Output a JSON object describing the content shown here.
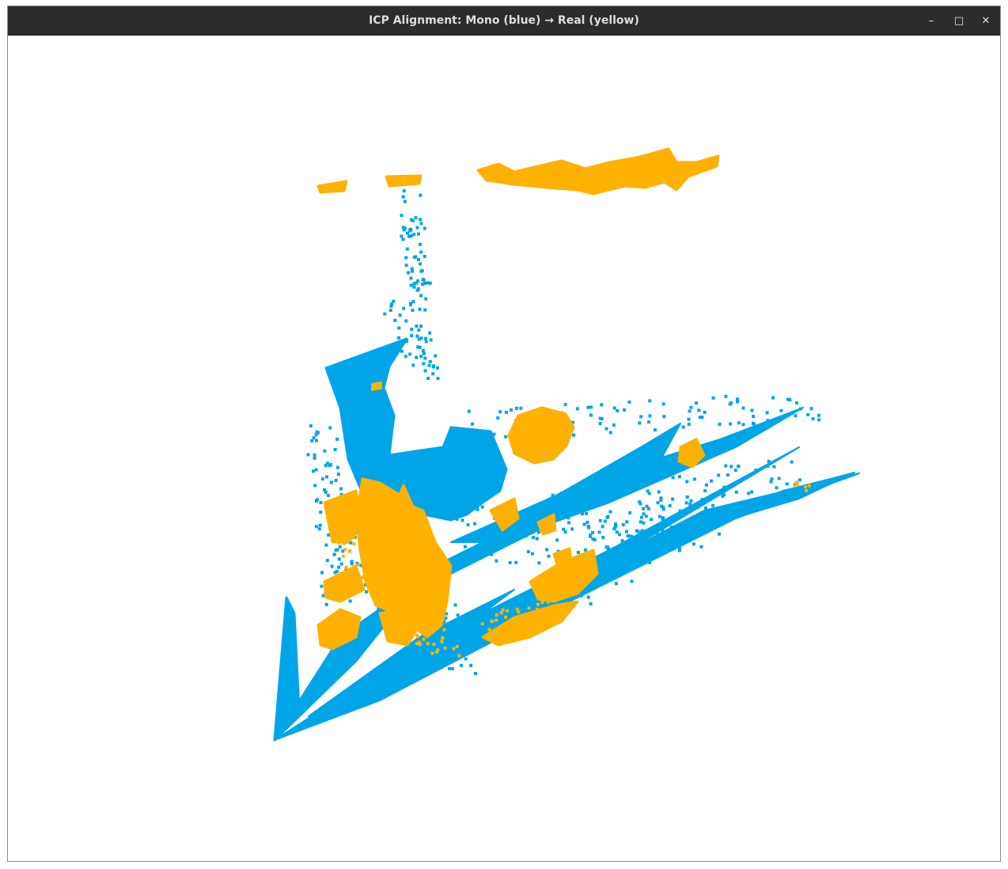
{
  "window": {
    "title": "ICP Alignment: Mono (blue) → Real (yellow)",
    "controls": {
      "minimize": "–",
      "maximize": "□",
      "close": "✕"
    }
  },
  "viewer": {
    "colors": {
      "background": "#ffffff",
      "mono": "#00a5e8",
      "real": "#ffb100",
      "titlebar": "#2c2c2c"
    },
    "icons": [
      "minimize-icon",
      "maximize-icon",
      "close-icon"
    ]
  }
}
